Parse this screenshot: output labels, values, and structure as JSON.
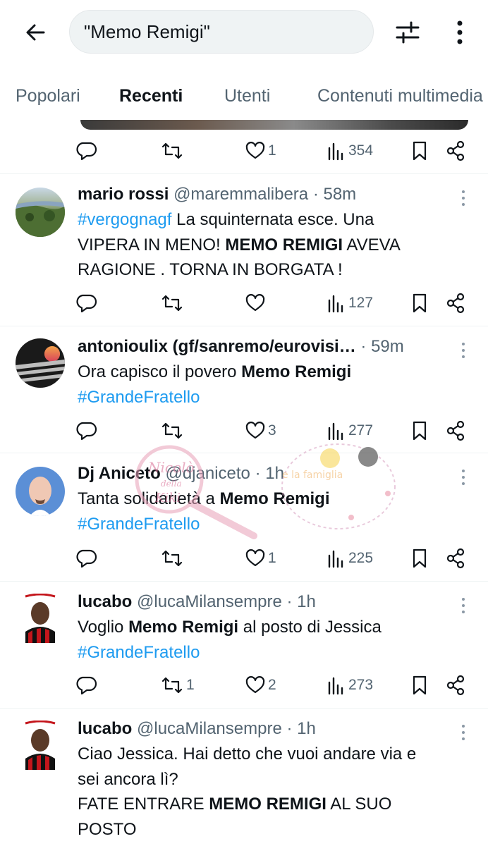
{
  "search": {
    "query": "\"Memo Remigi\""
  },
  "tabs": [
    "Popolari",
    "Recenti",
    "Utenti",
    "Contenuti multimedia"
  ],
  "prev_actions": {
    "likes": "1",
    "views": "354"
  },
  "tweets": [
    {
      "name": "mario rossi",
      "handle": "@maremmalibera",
      "time": "· 58m",
      "lines": [
        [
          {
            "t": "#vergognagf",
            "k": "tag"
          },
          {
            "t": " La squinternata esce. Una",
            "k": ""
          }
        ],
        [
          {
            "t": "VIPERA IN MENO! ",
            "k": ""
          },
          {
            "t": "MEMO REMIGI",
            "k": "b"
          },
          {
            "t": " AVEVA",
            "k": ""
          }
        ],
        [
          {
            "t": "RAGIONE . TORNA IN BORGATA !",
            "k": ""
          }
        ]
      ],
      "replies": "",
      "retweets": "",
      "likes": "",
      "views": "127"
    },
    {
      "name": "antonioulix (gf/sanremo/eurovisi…",
      "handle": "",
      "time": "· 59m",
      "lines": [
        [
          {
            "t": "Ora capisco il povero ",
            "k": ""
          },
          {
            "t": "Memo Remigi",
            "k": "b"
          }
        ],
        [
          {
            "t": "#GrandeFratello",
            "k": "tag"
          }
        ]
      ],
      "replies": "",
      "retweets": "",
      "likes": "3",
      "views": "277"
    },
    {
      "name": "Dj Aniceto",
      "handle": "@djaniceto",
      "time": "· 1h",
      "lines": [
        [
          {
            "t": "Tanta solidarietà a ",
            "k": ""
          },
          {
            "t": "Memo Remigi",
            "k": "b"
          }
        ],
        [
          {
            "t": "#GrandeFratello",
            "k": "tag"
          }
        ]
      ],
      "replies": "",
      "retweets": "",
      "likes": "1",
      "views": "225"
    },
    {
      "name": "lucabo",
      "handle": "@lucaMilansempre",
      "time": "· 1h",
      "lines": [
        [
          {
            "t": "Voglio ",
            "k": ""
          },
          {
            "t": "Memo Remigi",
            "k": "b"
          },
          {
            "t": " al posto di Jessica",
            "k": ""
          }
        ],
        [
          {
            "t": "#GrandeFratello",
            "k": "tag"
          }
        ]
      ],
      "replies": "",
      "retweets": "1",
      "likes": "2",
      "views": "273"
    },
    {
      "name": "lucabo",
      "handle": "@lucaMilansempre",
      "time": "· 1h",
      "lines": [
        [
          {
            "t": "Ciao Jessica. Hai detto che vuoi andare via e",
            "k": ""
          }
        ],
        [
          {
            "t": "sei ancora lì?",
            "k": ""
          }
        ],
        [
          {
            "t": "FATE ENTRARE ",
            "k": ""
          },
          {
            "t": "MEMO REMIGI",
            "k": "b"
          },
          {
            "t": " AL SUO",
            "k": ""
          }
        ],
        [
          {
            "t": "POSTO",
            "k": ""
          }
        ]
      ],
      "replies": "",
      "retweets": "",
      "likes": "",
      "views": ""
    }
  ],
  "watermark": {
    "text1": "Nicolò",
    "text2": "della",
    "text3": "Kiki",
    "text4": "e la famiglia"
  },
  "icons": {
    "back": "arrow-left-icon",
    "filter": "sliders-icon",
    "more": "more-vertical-icon",
    "reply": "reply-icon",
    "retweet": "retweet-icon",
    "like": "heart-icon",
    "views": "views-chart-icon",
    "bookmark": "bookmark-icon",
    "share": "share-icon"
  },
  "colors": {
    "accent": "#1d9bf0",
    "text": "#0f1419",
    "muted": "#536471"
  }
}
